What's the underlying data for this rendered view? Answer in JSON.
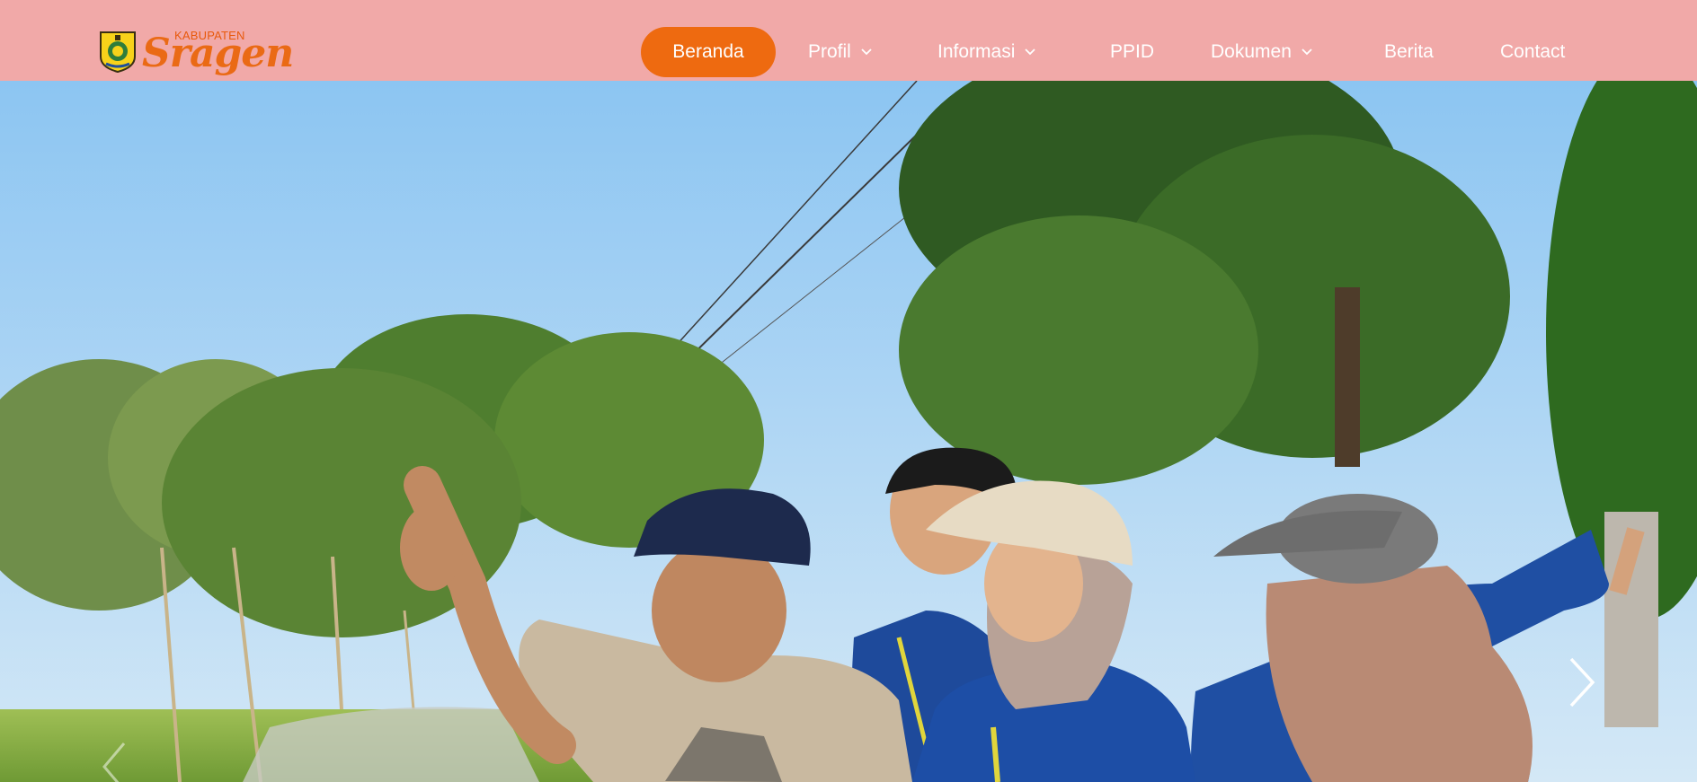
{
  "brand": {
    "small_text": "KABUPATEN",
    "name": "Sragen",
    "accent_color": "#ee6a10",
    "header_color": "#f1a9a8"
  },
  "nav": {
    "items": [
      {
        "label": "Beranda",
        "active": true,
        "dropdown": false
      },
      {
        "label": "Profil",
        "active": false,
        "dropdown": true
      },
      {
        "label": "Informasi",
        "active": false,
        "dropdown": true
      },
      {
        "label": "PPID",
        "active": false,
        "dropdown": false
      },
      {
        "label": "Dokumen",
        "active": false,
        "dropdown": true
      },
      {
        "label": "Berita",
        "active": false,
        "dropdown": false
      },
      {
        "label": "Contact",
        "active": false,
        "dropdown": false
      }
    ]
  },
  "hero": {
    "prev_icon": "chevron-left-icon",
    "next_icon": "chevron-right-icon"
  }
}
